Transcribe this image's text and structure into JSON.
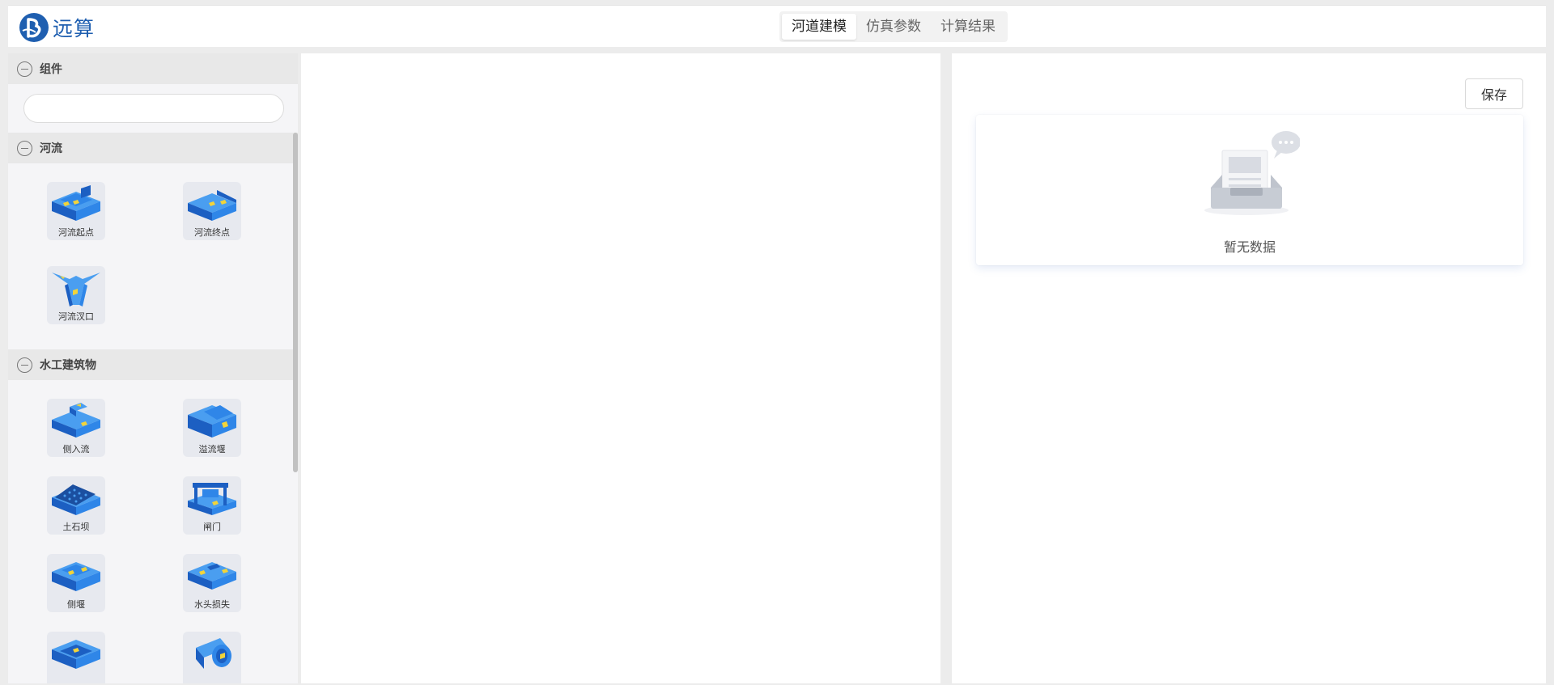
{
  "app": {
    "logo_text": "远算"
  },
  "tabs": [
    {
      "label": "河道建模",
      "active": true
    },
    {
      "label": "仿真参数",
      "active": false
    },
    {
      "label": "计算结果",
      "active": false
    }
  ],
  "sidebar": {
    "components_header": "组件",
    "search": {
      "value": "",
      "placeholder": ""
    },
    "groups": [
      {
        "title": "河流",
        "items": [
          "河流起点",
          "河流终点",
          "河流汊口"
        ]
      },
      {
        "title": "水工建筑物",
        "items": [
          "侧入流",
          "溢流堰",
          "土石坝",
          "闸门",
          "侧堰",
          "水头损失"
        ]
      }
    ]
  },
  "right_panel": {
    "save_label": "保存",
    "empty_text": "暂无数据"
  },
  "colors": {
    "brand": "#1f5fb0",
    "icon_blue": "#2f86e8",
    "icon_dark": "#1c5fc2",
    "water_yellow": "#f2d43a"
  }
}
